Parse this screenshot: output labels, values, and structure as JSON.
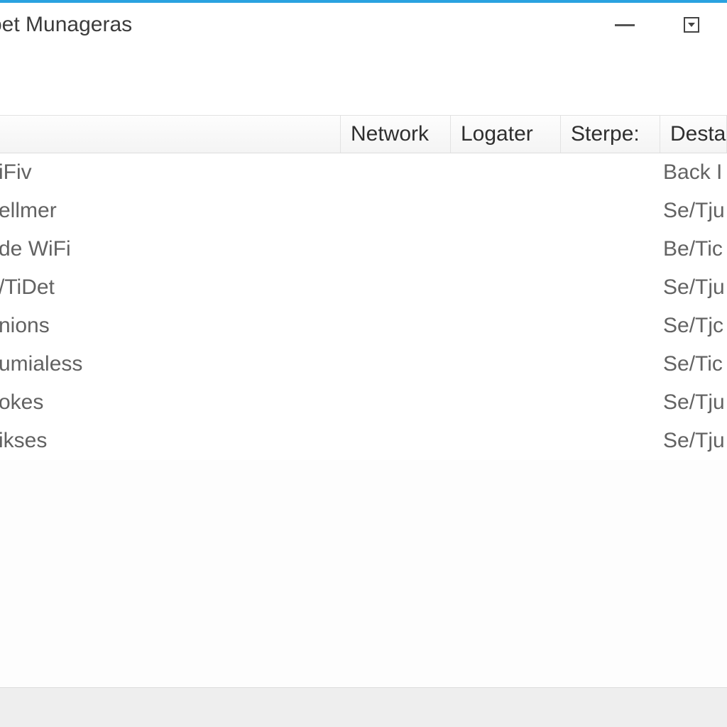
{
  "window": {
    "title": "oet Munageras"
  },
  "columns": {
    "c0": "",
    "c1": "Network",
    "c2": "Logater",
    "c3": "Sterpe:",
    "c4": "Destal"
  },
  "rows": [
    {
      "name": "iFiv",
      "network": "",
      "logater": "",
      "sterpe": "",
      "detail": "Back I"
    },
    {
      "name": "ellmer",
      "network": "",
      "logater": "",
      "sterpe": "",
      "detail": "Se/Tju"
    },
    {
      "name": "de WiFi",
      "network": "",
      "logater": "",
      "sterpe": "",
      "detail": "Be/Tic"
    },
    {
      "name": "/TiDet",
      "network": "",
      "logater": "",
      "sterpe": "",
      "detail": "Se/Tju"
    },
    {
      "name": "nions",
      "network": "",
      "logater": "",
      "sterpe": "",
      "detail": "Se/Tjc"
    },
    {
      "name": "umialess",
      "network": "",
      "logater": "",
      "sterpe": "",
      "detail": "Se/Tic"
    },
    {
      "name": "okes",
      "network": "",
      "logater": "",
      "sterpe": "",
      "detail": "Se/Tju"
    },
    {
      "name": "ikses",
      "network": "",
      "logater": "",
      "sterpe": "",
      "detail": "Se/Tju"
    }
  ]
}
